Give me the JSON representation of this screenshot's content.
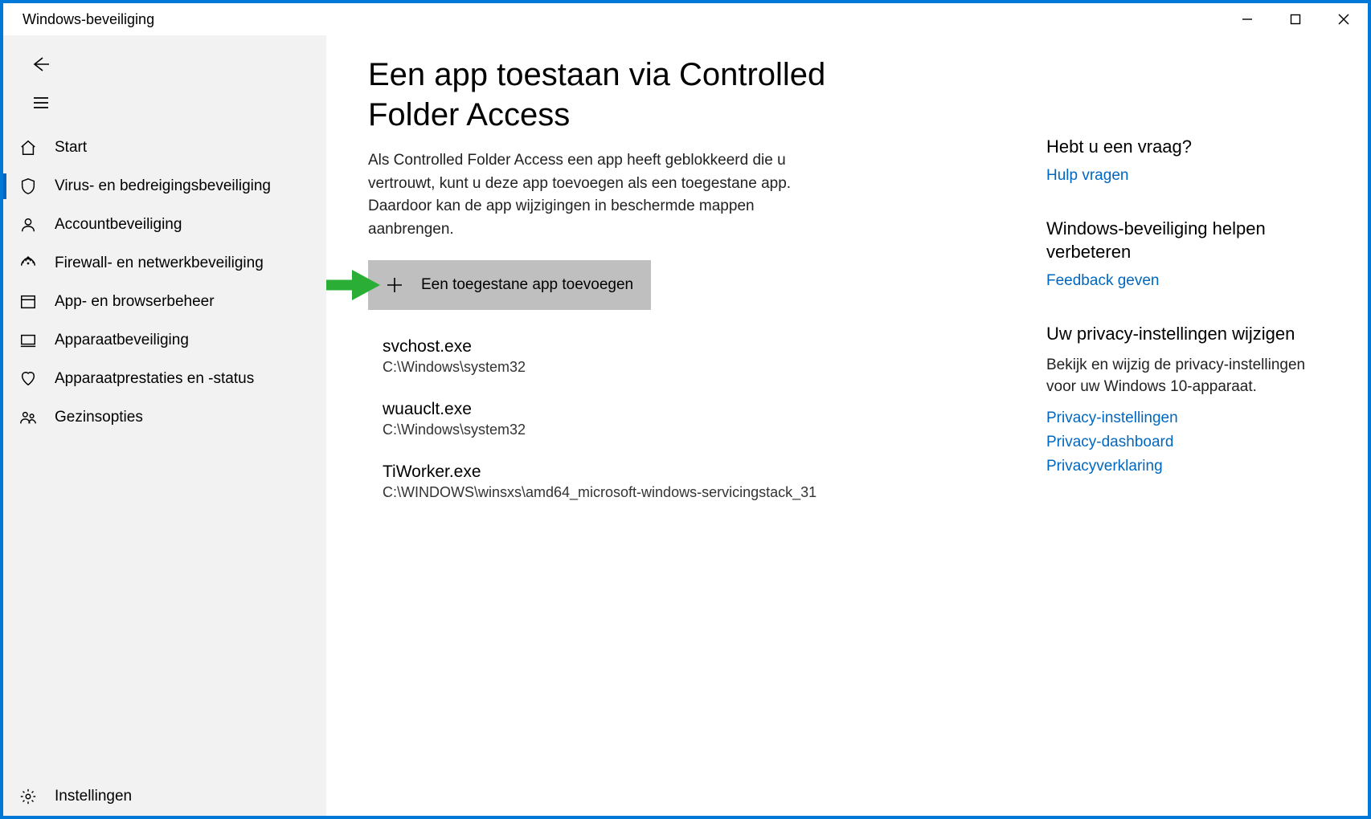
{
  "window": {
    "title": "Windows-beveiliging"
  },
  "sidebar": {
    "items": [
      {
        "label": "Start",
        "icon": "home"
      },
      {
        "label": "Virus- en bedreigingsbeveiliging",
        "icon": "shield",
        "selected": true
      },
      {
        "label": "Accountbeveiliging",
        "icon": "account"
      },
      {
        "label": "Firewall- en netwerkbeveiliging",
        "icon": "firewall"
      },
      {
        "label": "App- en browserbeheer",
        "icon": "app"
      },
      {
        "label": "Apparaatbeveiliging",
        "icon": "device"
      },
      {
        "label": "Apparaatprestaties en -status",
        "icon": "health"
      },
      {
        "label": "Gezinsopties",
        "icon": "family"
      }
    ],
    "settings_label": "Instellingen"
  },
  "main": {
    "heading": "Een app toestaan via Controlled Folder Access",
    "description": "Als Controlled Folder Access een app heeft geblokkeerd die u vertrouwt, kunt u deze app toevoegen als een toegestane app. Daardoor kan de app wijzigingen in beschermde mappen aanbrengen.",
    "add_button": "Een toegestane app toevoegen",
    "apps": [
      {
        "name": "svchost.exe",
        "path": "C:\\Windows\\system32"
      },
      {
        "name": "wuauclt.exe",
        "path": "C:\\Windows\\system32"
      },
      {
        "name": "TiWorker.exe",
        "path": "C:\\WINDOWS\\winsxs\\amd64_microsoft-windows-servicingstack_31"
      }
    ]
  },
  "aside": {
    "help": {
      "heading": "Hebt u een vraag?",
      "link": "Hulp vragen"
    },
    "improve": {
      "heading": "Windows-beveiliging helpen verbeteren",
      "link": "Feedback geven"
    },
    "privacy": {
      "heading": "Uw privacy-instellingen wijzigen",
      "text": "Bekijk en wijzig de privacy-instellingen voor uw Windows 10-apparaat.",
      "links": [
        "Privacy-instellingen",
        "Privacy-dashboard",
        "Privacyverklaring"
      ]
    }
  },
  "annotation": {
    "arrow_color": "#2bae36"
  }
}
